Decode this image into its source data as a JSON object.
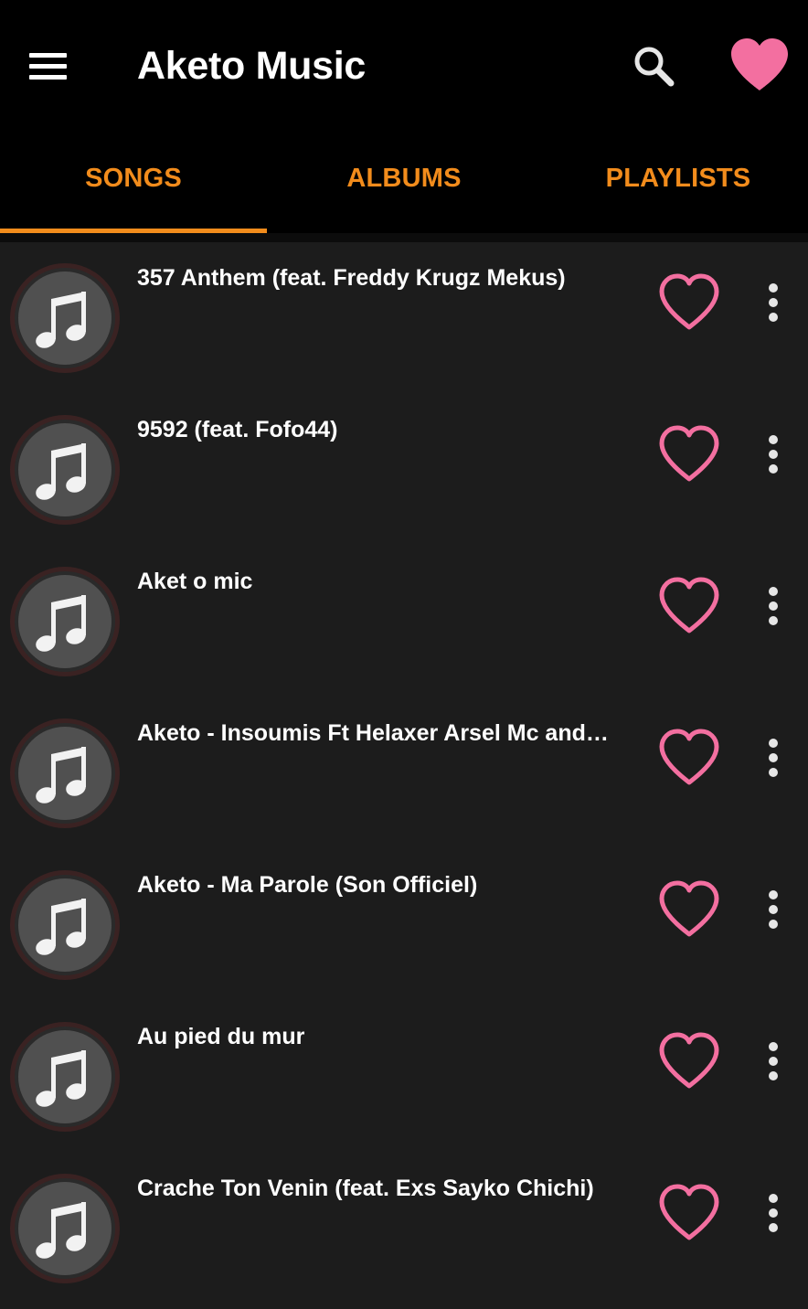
{
  "app": {
    "title": "Aketo Music",
    "accent_color": "#f28c1c",
    "heart_color": "#f36fa0",
    "icons": {
      "menu": "hamburger-menu-icon",
      "search": "search-icon",
      "favorites": "heart-filled-icon",
      "art": "music-note-icon",
      "like": "heart-outline-icon",
      "more": "more-vertical-icon"
    }
  },
  "tabs": [
    {
      "label": "SONGS",
      "active": true
    },
    {
      "label": "ALBUMS",
      "active": false
    },
    {
      "label": "PLAYLISTS",
      "active": false
    }
  ],
  "songs": [
    {
      "title": "357 Anthem (feat. Freddy Krugz  Mekus)"
    },
    {
      "title": "9592 (feat. Fofo44)"
    },
    {
      "title": "Aket o mic"
    },
    {
      "title": "Aketo - Insoumis Ft Helaxer  Arsel Mc and…"
    },
    {
      "title": "Aketo - Ma Parole (Son Officiel)"
    },
    {
      "title": "Au pied du mur"
    },
    {
      "title": "Crache Ton Venin (feat. Exs  Sayko Chichi)"
    }
  ]
}
